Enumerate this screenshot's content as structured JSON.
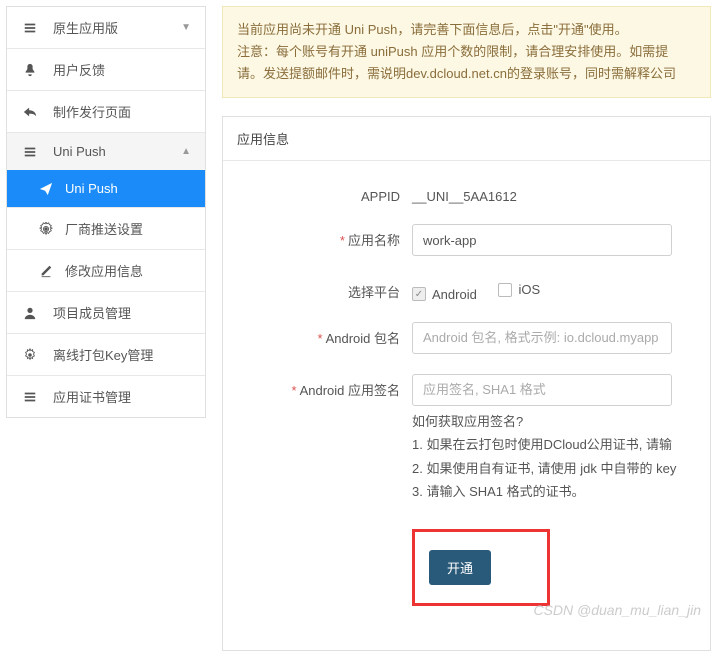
{
  "sidebar": {
    "items": [
      {
        "label": "原生应用版"
      },
      {
        "label": "用户反馈"
      },
      {
        "label": "制作发行页面"
      },
      {
        "label": "Uni Push",
        "sub": [
          {
            "label": "Uni Push"
          },
          {
            "label": "厂商推送设置"
          },
          {
            "label": "修改应用信息"
          }
        ]
      },
      {
        "label": "项目成员管理"
      },
      {
        "label": "离线打包Key管理"
      },
      {
        "label": "应用证书管理"
      }
    ]
  },
  "alert": {
    "line1": "当前应用尚未开通 Uni Push，请完善下面信息后，点击\"开通\"使用。",
    "line2": "注意：每个账号有开通 uniPush 应用个数的限制，请合理安排使用。如需提",
    "line3": "请。发送提额邮件时，需说明dev.dcloud.net.cn的登录账号，同时需解释公司"
  },
  "panel": {
    "title": "应用信息"
  },
  "form": {
    "appid": {
      "label": "APPID",
      "value": "__UNI__5AA1612"
    },
    "appname": {
      "label": "应用名称",
      "value": "work-app"
    },
    "platform": {
      "label": "选择平台",
      "android": "Android",
      "ios": "iOS"
    },
    "pkg": {
      "label": "Android 包名",
      "placeholder": "Android 包名, 格式示例: io.dcloud.myapp"
    },
    "sign": {
      "label": "Android 应用签名",
      "placeholder": "应用签名, SHA1 格式"
    },
    "help": {
      "q": "如何获取应用签名?",
      "l1": "1. 如果在云打包时使用DCloud公用证书, 请输",
      "l2": "2. 如果使用自有证书, 请使用 jdk 中自带的 key",
      "l3": "3. 请输入 SHA1 格式的证书。"
    },
    "submit": "开通"
  },
  "watermark": "CSDN @duan_mu_lian_jin"
}
